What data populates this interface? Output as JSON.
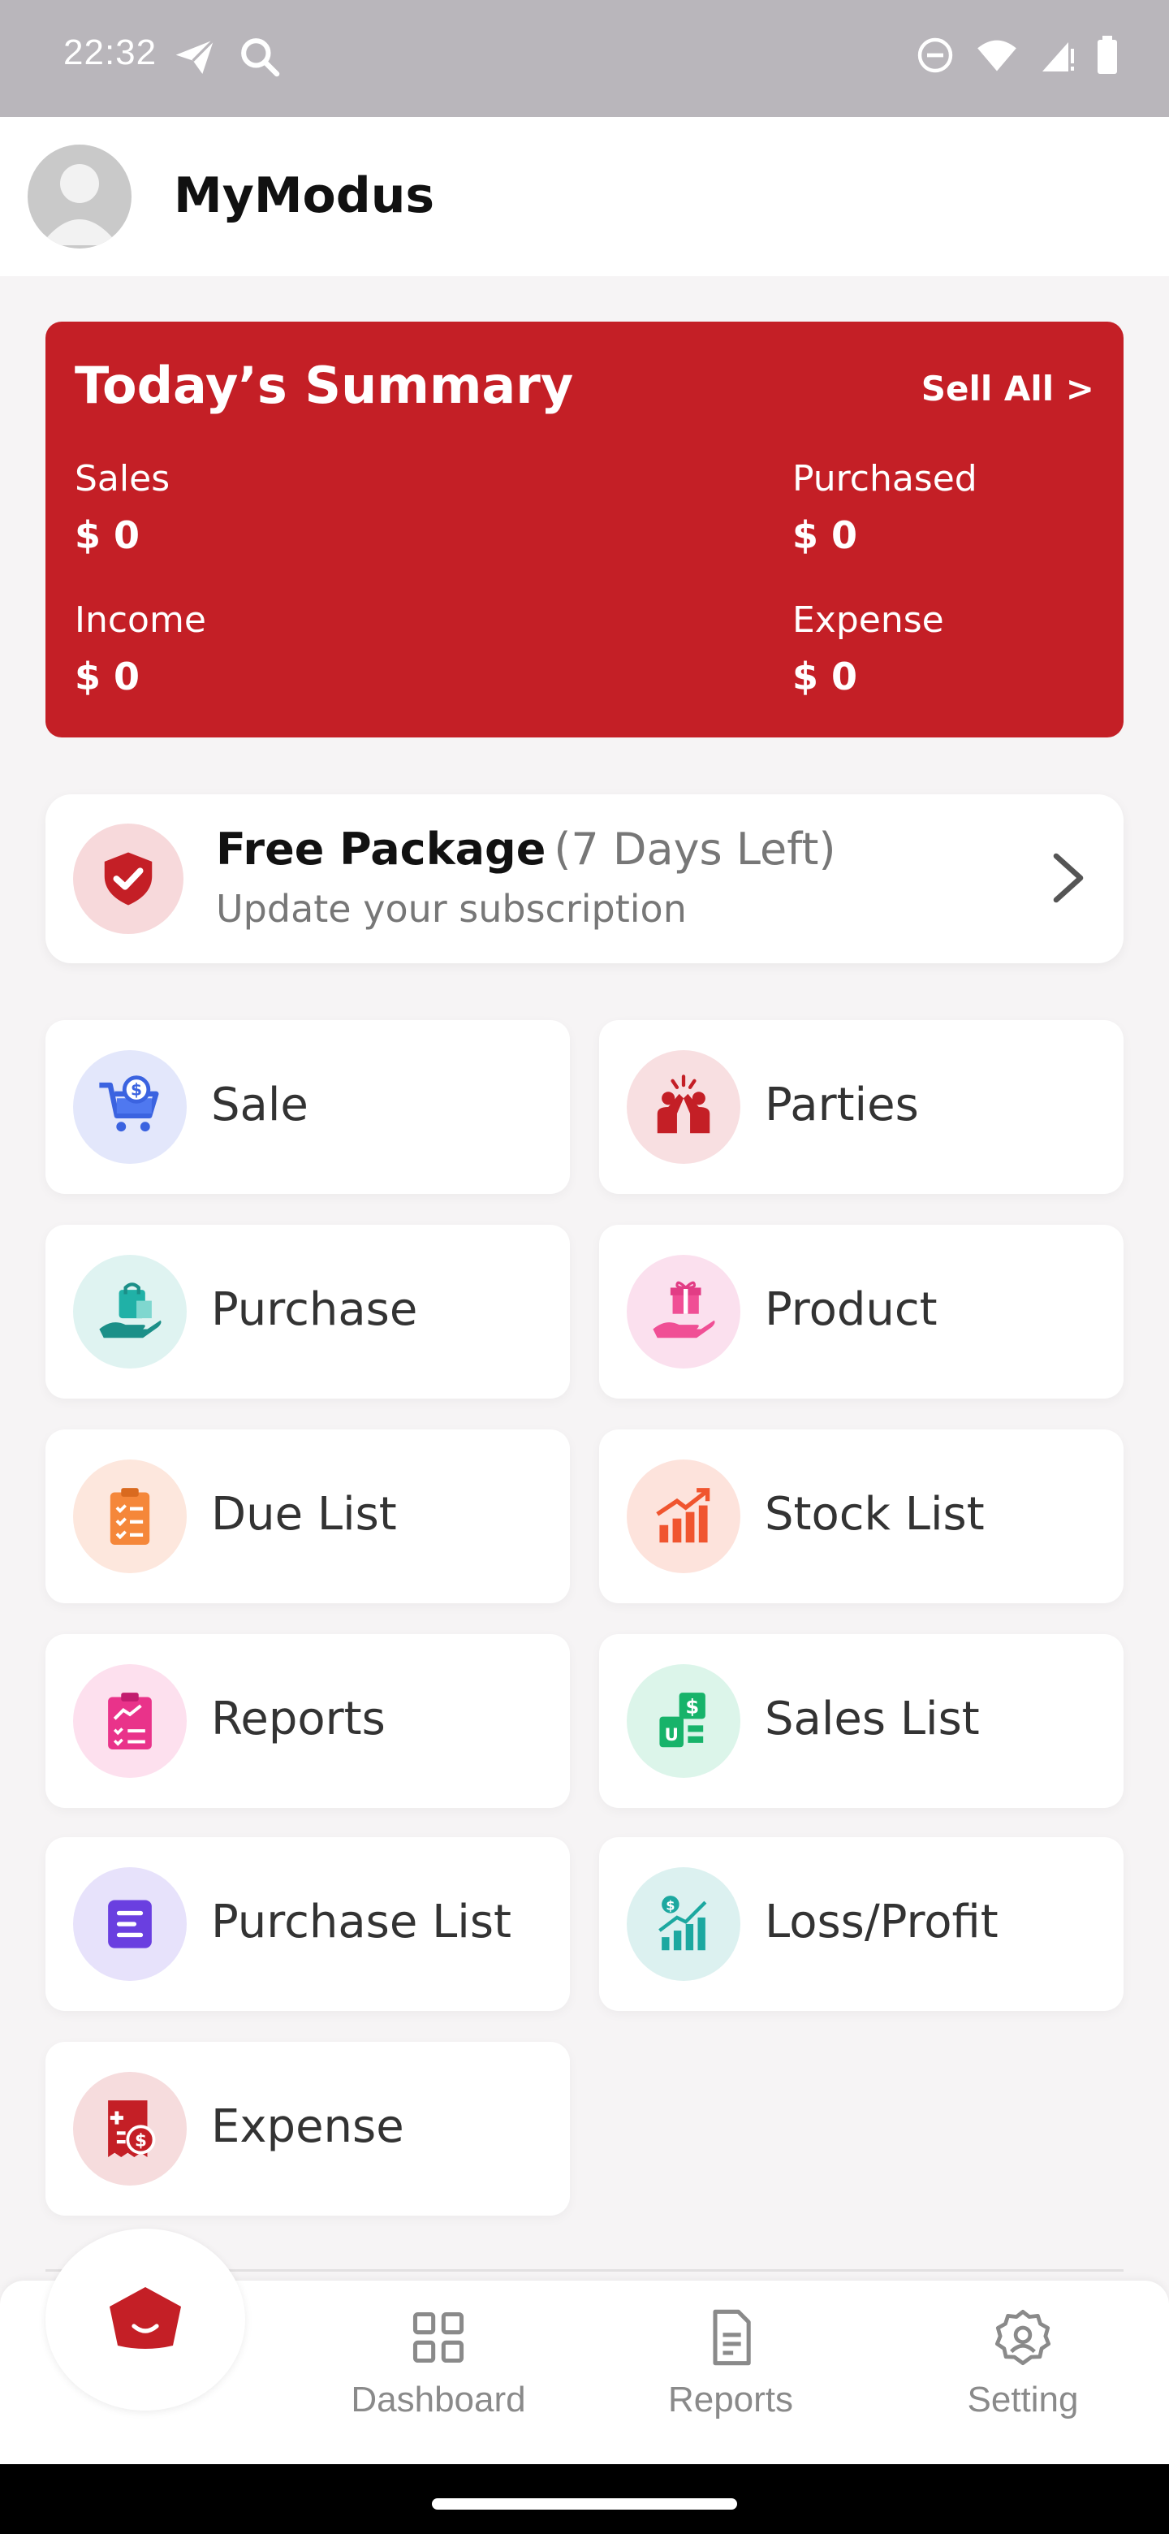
{
  "status_bar": {
    "time": "22:32",
    "left_icons": [
      "telegram-icon",
      "search-icon"
    ],
    "right_icons": [
      "do-not-disturb-icon",
      "wifi-icon",
      "signal-icon",
      "battery-icon"
    ]
  },
  "header": {
    "title": "MyModus",
    "avatar_icon": "user-avatar-icon"
  },
  "summary": {
    "title": "Today’s Summary",
    "link": "Sell All >",
    "items": [
      {
        "label": "Sales",
        "value": "$ 0"
      },
      {
        "label": "Purchased",
        "value": "$ 0"
      },
      {
        "label": "Income",
        "value": "$ 0"
      },
      {
        "label": "Expense",
        "value": "$ 0"
      }
    ],
    "bg_color": "#c41f26"
  },
  "package": {
    "title": "Free Package",
    "days": "(7 Days Left)",
    "subtitle": "Update your subscription",
    "icon": "shield-check-icon"
  },
  "menu": [
    {
      "label": "Sale",
      "icon": "cart-icon"
    },
    {
      "label": "Parties",
      "icon": "high-five-icon"
    },
    {
      "label": "Purchase",
      "icon": "shopping-bag-hand-icon"
    },
    {
      "label": "Product",
      "icon": "gift-hand-icon"
    },
    {
      "label": "Due List",
      "icon": "clipboard-list-icon"
    },
    {
      "label": "Stock List",
      "icon": "bar-chart-up-icon"
    },
    {
      "label": "Reports",
      "icon": "report-clipboard-icon"
    },
    {
      "label": "Sales List",
      "icon": "money-bag-icon"
    },
    {
      "label": "Purchase List",
      "icon": "document-list-icon"
    },
    {
      "label": "Loss/Profit",
      "icon": "profit-chart-icon"
    },
    {
      "label": "Expense",
      "icon": "receipt-icon"
    }
  ],
  "bottom_nav": {
    "home_icon": "home-pentagon-icon",
    "items": [
      {
        "label": "Dashboard",
        "icon": "grid-icon"
      },
      {
        "label": "Reports",
        "icon": "document-icon"
      },
      {
        "label": "Setting",
        "icon": "gear-icon"
      }
    ]
  }
}
